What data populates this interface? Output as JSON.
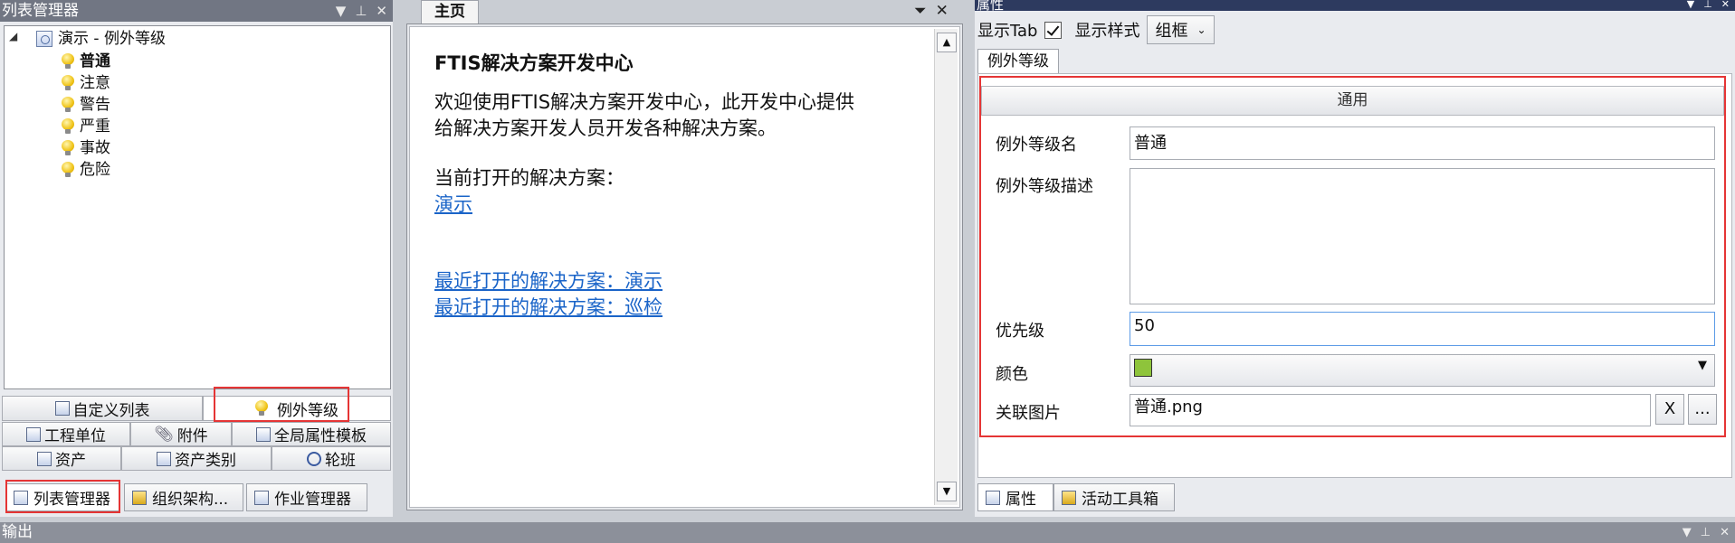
{
  "left": {
    "title": "列表管理器",
    "tree_root": "演示 - 例外等级",
    "tree_items": [
      "普通",
      "注意",
      "警告",
      "严重",
      "事故",
      "危险"
    ],
    "category_buttons": [
      "自定义列表",
      "例外等级",
      "工程单位",
      "附件",
      "全局属性模板",
      "资产",
      "资产类别",
      "轮班"
    ],
    "bottom_tabs": [
      "列表管理器",
      "组织架构...",
      "作业管理器"
    ]
  },
  "center": {
    "tab": "主页",
    "heading": "FTIS解决方案开发中心",
    "intro_line1": "欢迎使用FTIS解决方案开发中心，此开发中心提供",
    "intro_line2": "给解决方案开发人员开发各种解决方案。",
    "current_label": "当前打开的解决方案：",
    "current_link": "演示",
    "recent1": "最近打开的解决方案：演示",
    "recent2": "最近打开的解决方案：巡检"
  },
  "right": {
    "title": "属性",
    "show_tab_label": "显示Tab",
    "show_style_label": "显示样式",
    "style_value": "组框",
    "prop_tab": "例外等级",
    "group_header": "通用",
    "name_label": "例外等级名",
    "name_value": "普通",
    "desc_label": "例外等级描述",
    "desc_value": "",
    "priority_label": "优先级",
    "priority_value": "50",
    "color_label": "颜色",
    "color_value": "#8ec43b",
    "image_label": "关联图片",
    "image_value": "普通.png",
    "clear_btn": "X",
    "browse_btn": "...",
    "bottom_tabs": [
      "属性",
      "活动工具箱"
    ]
  },
  "output": {
    "title": "输出"
  }
}
